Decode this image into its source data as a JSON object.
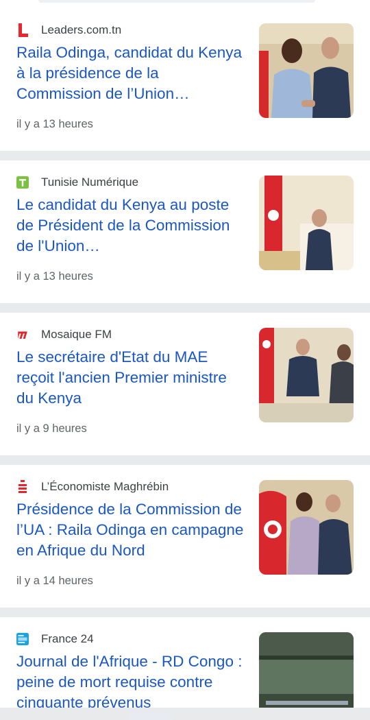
{
  "colors": {
    "headline": "#1a57c1",
    "source_text": "#3c4043",
    "time_text": "#5f6368",
    "separator": "#e9eaec"
  },
  "articles": [
    {
      "source": "Leaders.com.tn",
      "source_icon": "leaders-l-logo",
      "headline": "Raila Odinga, candidat du Kenya à la présidence de la Commission de l’Union…",
      "time": "il y a 13 heures",
      "thumbnail": "odinga-handshake-photo"
    },
    {
      "source": "Tunisie Numérique",
      "source_icon": "tunisie-numerique-t-logo",
      "headline": "Le candidat du Kenya au poste de Président de la Commission de l'Union…",
      "time": "il y a 13 heures",
      "thumbnail": "official-seated-photo"
    },
    {
      "source": "Mosaique FM",
      "source_icon": "mosaique-m-logo",
      "headline": "Le secrétaire d'Etat du MAE reçoit l'ancien Premier ministre du Kenya",
      "time": "il y a 9 heures",
      "thumbnail": "meeting-photo"
    },
    {
      "source": "L’Économiste Maghrébin",
      "source_icon": "economiste-logo",
      "headline": "Présidence de la Commission de l’UA : Raila Odinga en campagne en Afrique du Nord",
      "time": "il y a 14 heures",
      "thumbnail": "flag-handshake-photo"
    },
    {
      "source": "France 24",
      "source_icon": "france24-logo",
      "headline": "Journal de l'Afrique - RD Congo : peine de mort requise contre cinquante prévenus",
      "time": "",
      "thumbnail": "courtroom-photo"
    }
  ]
}
